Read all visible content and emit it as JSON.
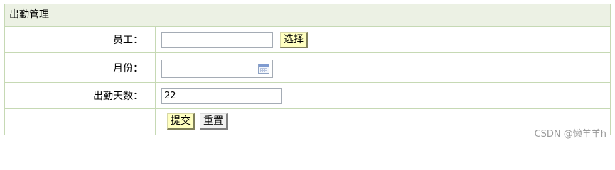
{
  "form": {
    "title": "出勤管理",
    "fields": {
      "employee": {
        "label": "员工：",
        "value": "",
        "select_button": "选择"
      },
      "month": {
        "label": "月份：",
        "value": ""
      },
      "attendance_days": {
        "label": "出勤天数：",
        "value": "22"
      }
    },
    "actions": {
      "submit": "提交",
      "reset": "重置"
    }
  },
  "watermark": "CSDN @懒羊羊h"
}
